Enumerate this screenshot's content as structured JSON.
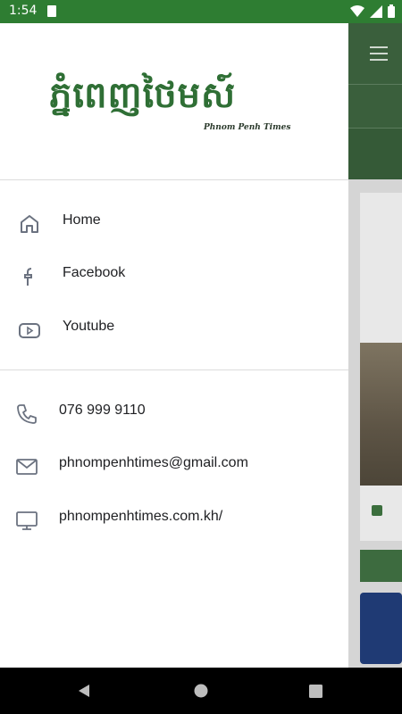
{
  "status": {
    "time": "1:54"
  },
  "drawer": {
    "logo_khmer": "ភ្នំពេញថៃមស៍",
    "logo_english": "Phnom Penh Times",
    "nav_items": [
      {
        "label": "Home",
        "icon": "home-icon"
      },
      {
        "label": "Facebook",
        "icon": "facebook-icon"
      },
      {
        "label": "Youtube",
        "icon": "youtube-icon"
      }
    ],
    "contacts": [
      {
        "label": "076 999 9110",
        "icon": "phone-icon"
      },
      {
        "label": "phnompenhtimes@gmail.com",
        "icon": "mail-icon"
      },
      {
        "label": "phnompenhtimes.com.kh/",
        "icon": "monitor-icon"
      }
    ]
  },
  "colors": {
    "status_bar": "#2e7d32",
    "brand_green": "#2f6f35"
  }
}
